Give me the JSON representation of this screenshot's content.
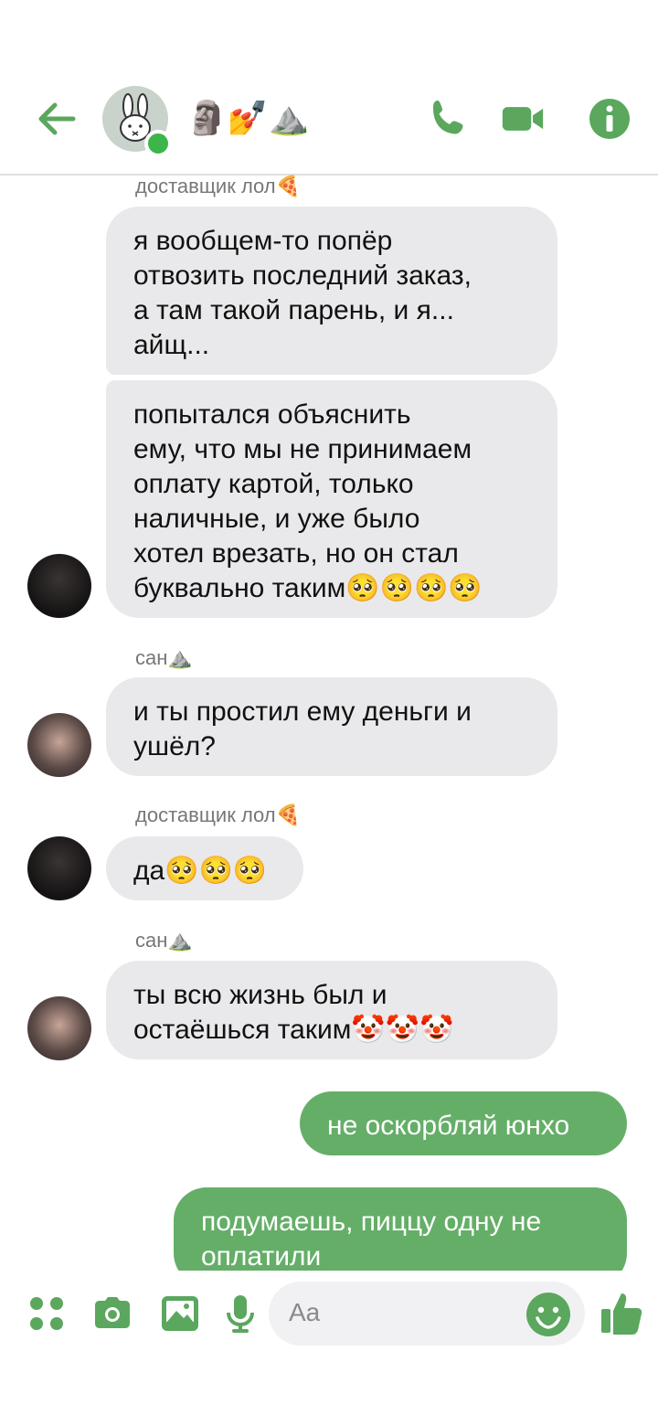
{
  "header": {
    "title_emojis": "🗿💅⛰️",
    "accent": "#5aa75d"
  },
  "messages": [
    {
      "sender": "доставщик лол🍕"
    },
    {
      "text": "я вообщем-то попёр\nотвозить последний заказ,\nа там такой парень, и я...\nайщ..."
    },
    {
      "text": "попытался объяснить\nему, что мы не принимаем\nоплату картой, только\nналичные, и уже было\nхотел врезать, но он стал\nбуквально таким🥺🥺🥺🥺"
    },
    {
      "sender": "сан⛰️"
    },
    {
      "text": "и ты простил ему деньги и\nушёл?"
    },
    {
      "sender": "доставщик лол🍕"
    },
    {
      "text": "да🥺🥺🥺"
    },
    {
      "sender": "сан⛰️"
    },
    {
      "text": "ты всю жизнь был и\nостаёшься таким🤡🤡🤡"
    },
    {
      "text": "не оскорбляй юнхо"
    },
    {
      "text": "подумаешь, пиццу одну не\nоплатили"
    }
  ],
  "composer": {
    "placeholder": "Aa"
  }
}
